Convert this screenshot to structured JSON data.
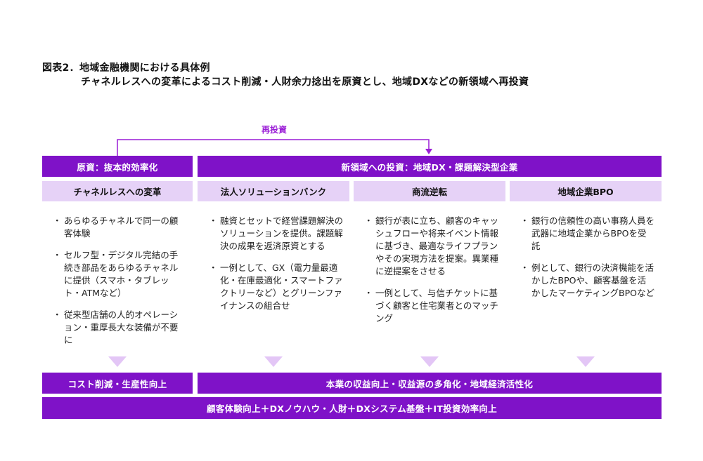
{
  "figure": {
    "title": "図表2．地域金融機関における具体例",
    "subtitle": "チャネルレスへの変革によるコスト削減・人財余力捻出を原資とし、地域DXなどの新領域へ再投資"
  },
  "reinvest_label": "再投資",
  "left_header": "原資：抜本的効率化",
  "right_header": "新領域への投資：地域DX・課題解決型企業",
  "columns": [
    {
      "title": "チャネルレスへの変革",
      "bullets": [
        "あらゆるチャネルで同一の顧客体験",
        "セルフ型・デジタル完結の手続き部品をあらゆるチャネルに提供（スマホ・タブレット・ATMなど）",
        "従来型店舗の人的オペレーション・重厚長大な装備が不要に"
      ]
    },
    {
      "title": "法人ソリューションバンク",
      "bullets": [
        "融資とセットで経営課題解決のソリューションを提供。課題解決の成果を返済原資とする",
        "一例として、GX（電力量最適化・在庫最適化・スマートファクトリーなど）とグリーンファイナンスの組合せ"
      ]
    },
    {
      "title": "商流逆転",
      "bullets": [
        "銀行が表に立ち、顧客のキャッシュフローや将来イベント情報に基づき、最適なライフプランやその実現方法を提案。異業種に逆提案をさせる",
        "一例として、与信チケットに基づく顧客と住宅業者とのマッチング"
      ]
    },
    {
      "title": "地域企業BPO",
      "bullets": [
        "銀行の信頼性の高い事務人員を武器に地域企業からBPOを受託",
        "例として、銀行の決済機能を活かしたBPOや、顧客基盤を活かしたマーケティングBPOなど"
      ]
    }
  ],
  "left_result": "コスト削減・生産性向上",
  "right_result": "本業の収益向上・収益源の多角化・地域経済活性化",
  "bottom_bar": "顧客体験向上＋DXノウハウ・人財＋DXシステム基盤＋IT投資効率向上",
  "colors": {
    "accent": "#7f12c8",
    "light": "#e6d2f7",
    "triangle": "#e3c6f6",
    "arrow": "#9a1dd6"
  }
}
